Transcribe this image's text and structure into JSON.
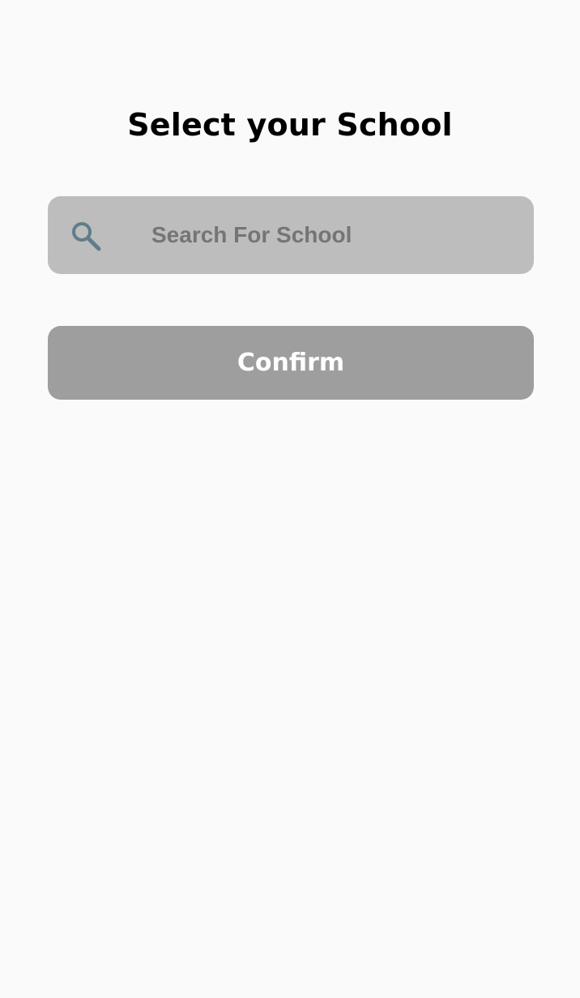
{
  "title": "Select your School",
  "search": {
    "placeholder": "Search For School",
    "value": "",
    "icon": "search-icon"
  },
  "confirm": {
    "label": "Confirm",
    "state": "disabled"
  },
  "colors": {
    "background": "#fafafa",
    "search_box": "#bdbdbd",
    "search_icon": "#607d8b",
    "placeholder_text": "#757575",
    "button_disabled": "#9e9e9e",
    "button_text": "#ffffff",
    "title_text": "#000000"
  }
}
